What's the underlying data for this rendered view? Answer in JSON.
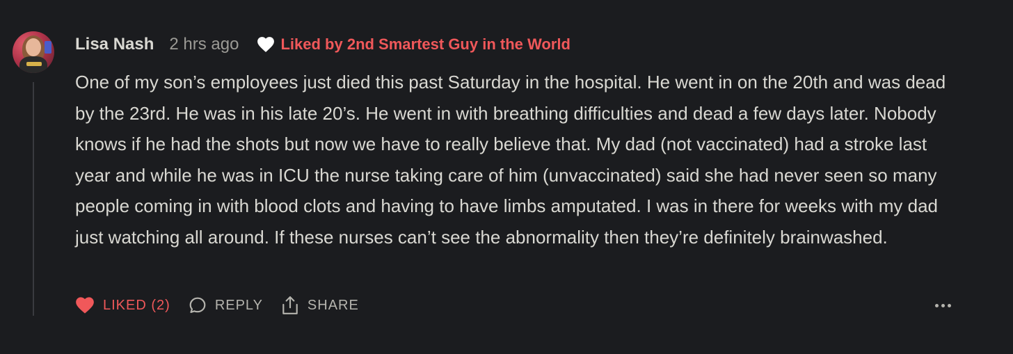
{
  "comment": {
    "author": "Lisa Nash",
    "timestamp": "2 hrs ago",
    "liked_by": "Liked by 2nd Smartest Guy in the World",
    "body": "One of my son’s employees just died this past Saturday in the hospital. He went in on the 20th and was dead by the 23rd. He was in his late 20’s. He went in with breathing difficulties and dead a few days later. Nobody knows if he had the shots but now we have to really believe that. My dad (not vaccinated) had a stroke last year and while he was in ICU the nurse taking care of him (unvaccinated) said she had never seen so many people coming in with blood clots and having to have limbs amputated. I was in there for weeks with my dad just watching all around. If these nurses can’t see the abnormality then they’re definitely brainwashed."
  },
  "actions": {
    "like_label": "LIKED (2)",
    "reply_label": "REPLY",
    "share_label": "SHARE"
  },
  "icons": {
    "avatar": "user-avatar",
    "liked_by": "heart-icon",
    "like": "heart-filled-icon",
    "reply": "speech-bubble-icon",
    "share": "share-upload-icon",
    "more": "more-horizontal-icon"
  },
  "colors": {
    "background": "#1b1c1f",
    "text": "#d9d8d2",
    "muted": "#9b9a95",
    "accent_red": "#f0585a"
  }
}
